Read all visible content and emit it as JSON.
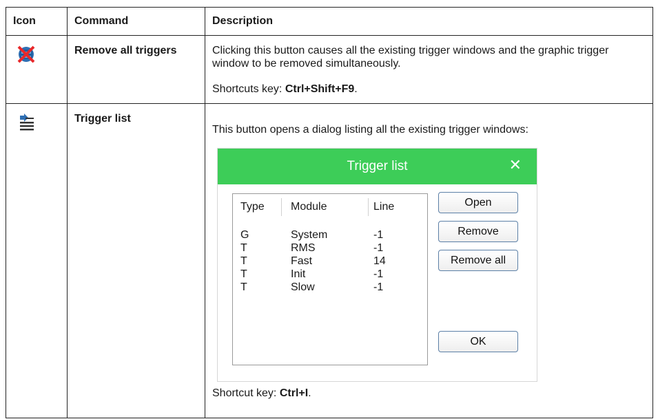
{
  "table": {
    "headers": {
      "icon": "Icon",
      "command": "Command",
      "description": "Description"
    },
    "rows": [
      {
        "icon": "remove-all-triggers-icon",
        "command": "Remove all triggers",
        "desc_line1": "Clicking this button causes all the existing trigger windows and the graphic trigger window to be removed simultaneously.",
        "shortcut_prefix": "Shortcuts key: ",
        "shortcut_key": "Ctrl+Shift+F9",
        "shortcut_suffix": "."
      },
      {
        "icon": "trigger-list-icon",
        "command": "Trigger list",
        "desc_line1": "This button opens a dialog listing all the existing trigger windows:",
        "shortcut_prefix": "Shortcut key: ",
        "shortcut_key": "Ctrl+I",
        "shortcut_suffix": "."
      }
    ]
  },
  "dialog": {
    "title": "Trigger list",
    "close_glyph": "✕",
    "accent_color": "#3dcd58",
    "columns": [
      "Type",
      "Module",
      "Line"
    ],
    "items": [
      {
        "type": "G",
        "module": "System",
        "line": "-1"
      },
      {
        "type": "T",
        "module": "RMS",
        "line": "-1"
      },
      {
        "type": "T",
        "module": "Fast",
        "line": "14"
      },
      {
        "type": "T",
        "module": "Init",
        "line": "-1"
      },
      {
        "type": "T",
        "module": "Slow",
        "line": "-1"
      }
    ],
    "buttons": {
      "open": "Open",
      "remove": "Remove",
      "remove_all": "Remove all",
      "ok": "OK"
    }
  }
}
